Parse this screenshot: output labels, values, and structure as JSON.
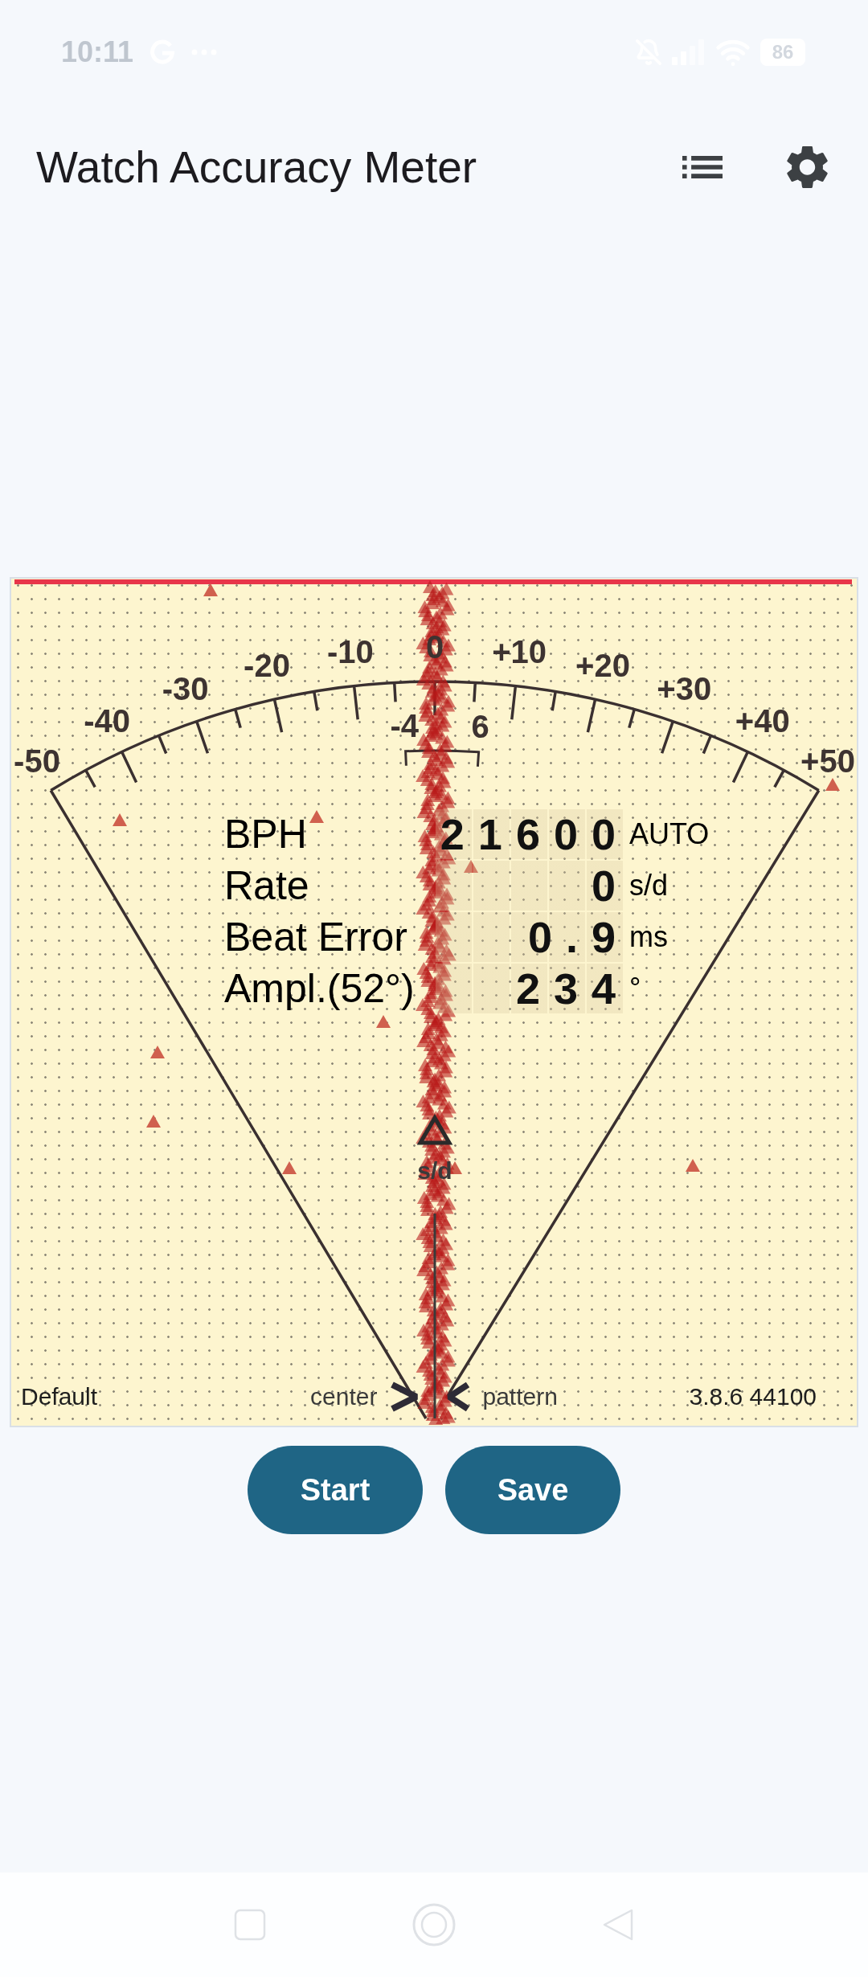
{
  "status_bar": {
    "time": "10:11",
    "battery": "86"
  },
  "app_bar": {
    "title": "Watch Accuracy Meter"
  },
  "meter": {
    "scale_labels": [
      "-50",
      "-40",
      "-30",
      "-20",
      "-10",
      "0",
      "+10",
      "+20",
      "+30",
      "+40",
      "+50"
    ],
    "tolerance_labels": [
      "-4",
      "6"
    ],
    "needle_unit": "s/d",
    "readings": [
      {
        "label": "BPH",
        "value": "21600",
        "unit": "AUTO"
      },
      {
        "label": "Rate",
        "value": "0",
        "unit": "s/d"
      },
      {
        "label": "Beat Error",
        "value": "0.9",
        "unit": "ms"
      },
      {
        "label": "Ampl.(52°)",
        "value": "234",
        "unit": "°"
      }
    ],
    "footer": {
      "profile": "Default",
      "center": "center",
      "pattern": "pattern",
      "version": "3.8.6 44100"
    }
  },
  "buttons": [
    {
      "label": "Start"
    },
    {
      "label": "Save"
    }
  ]
}
